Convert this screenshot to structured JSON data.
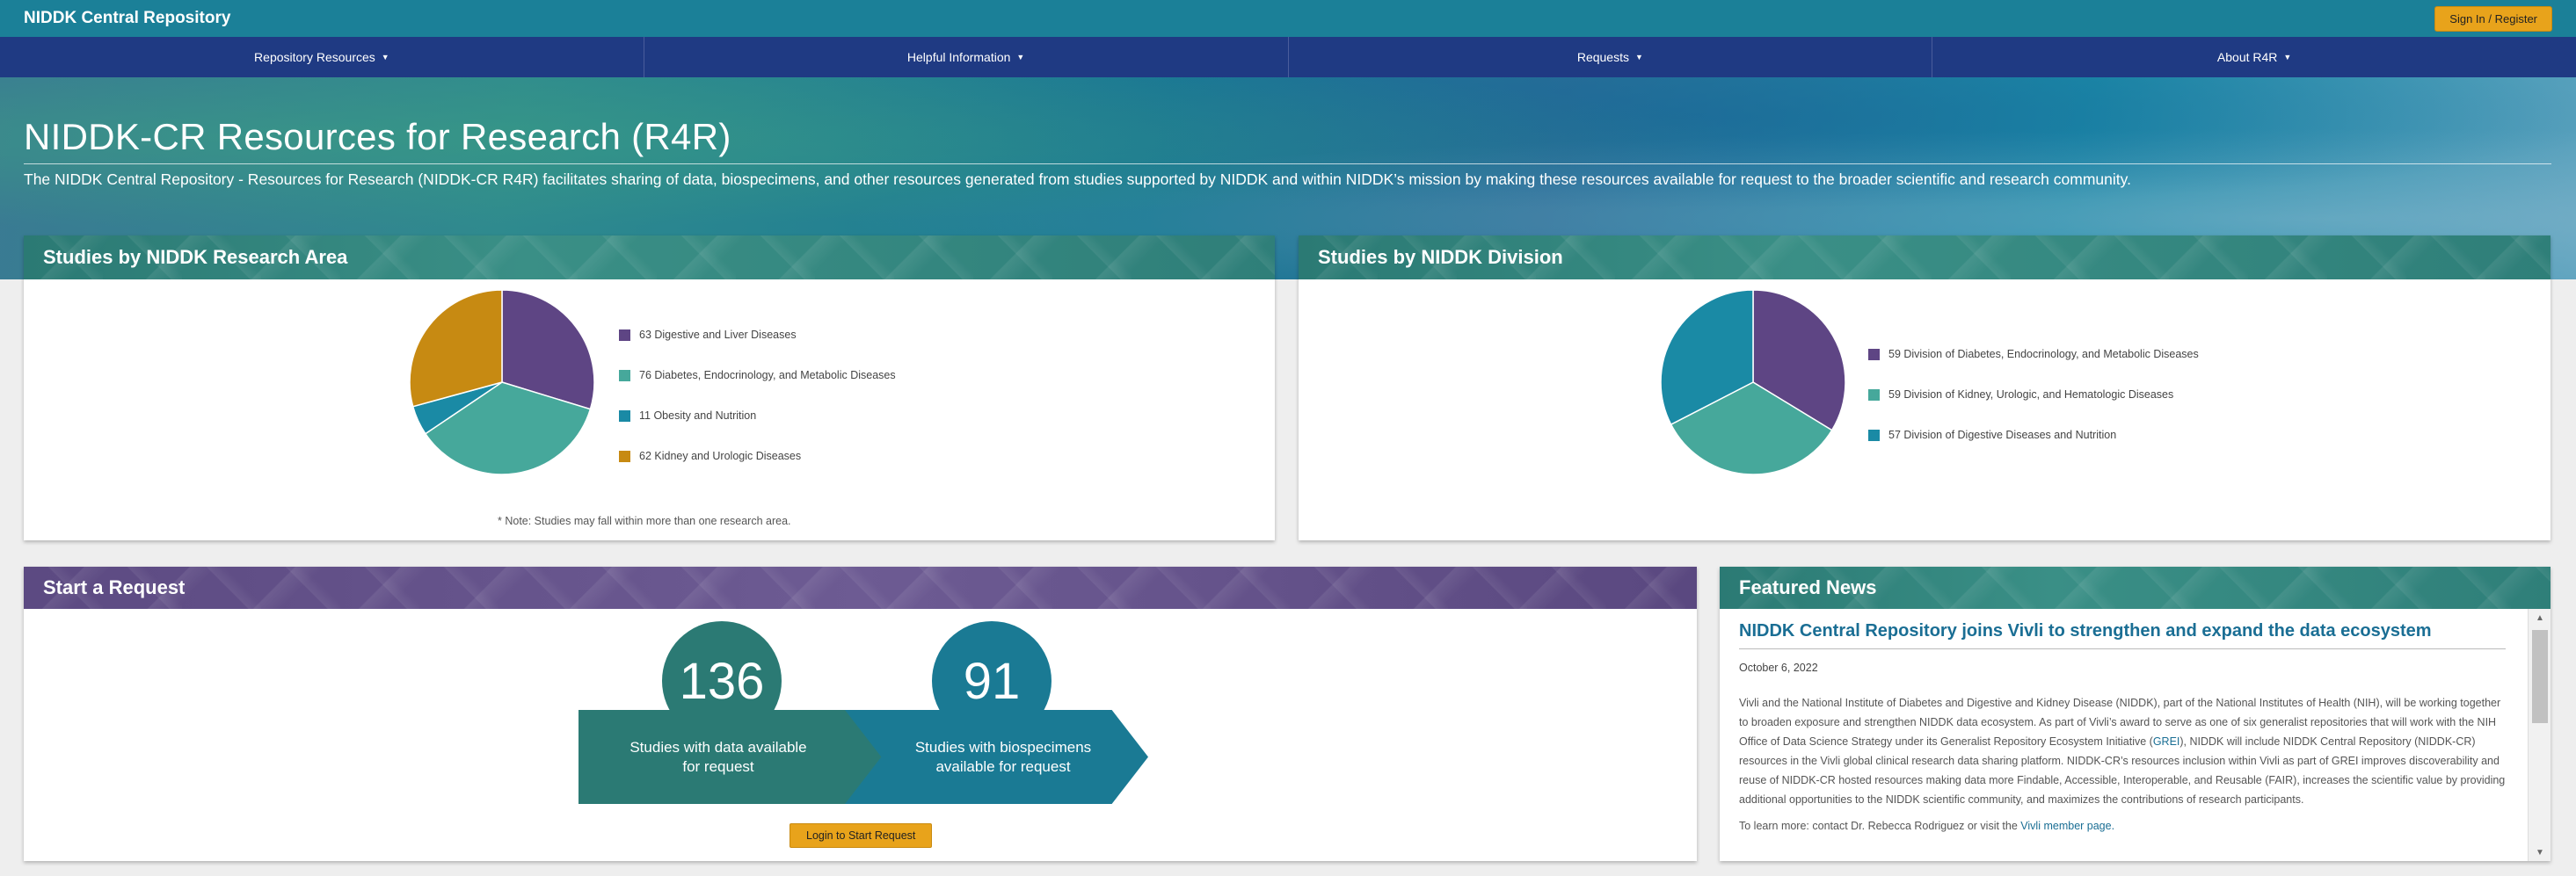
{
  "header": {
    "brand": "NIDDK Central Repository",
    "signin_label": "Sign In / Register"
  },
  "nav": {
    "items": [
      {
        "label": "Repository Resources"
      },
      {
        "label": "Helpful Information"
      },
      {
        "label": "Requests"
      },
      {
        "label": "About R4R"
      }
    ]
  },
  "hero": {
    "title": "NIDDK-CR Resources for Research (R4R)",
    "description": "The NIDDK Central Repository - Resources for Research (NIDDK-CR R4R) facilitates sharing of data, biospecimens, and other resources generated from studies supported by NIDDK and within NIDDK’s mission by making these resources available for request to the broader scientific and research community."
  },
  "colors": {
    "purple": "#5e4584",
    "teal": "#46a89b",
    "cyan": "#1a8aa5",
    "gold": "#c78a12"
  },
  "research_area": {
    "title": "Studies by NIDDK Research Area",
    "legend": [
      "63 Digestive and Liver Diseases",
      "76 Diabetes, Endocrinology, and Metabolic Diseases",
      "11 Obesity and Nutrition",
      "62 Kidney and Urologic Diseases"
    ],
    "note": "* Note: Studies may fall within more than one research area."
  },
  "division": {
    "title": "Studies by NIDDK Division",
    "legend": [
      "59 Division of Diabetes, Endocrinology, and Metabolic Diseases",
      "59 Division of Kidney, Urologic, and Hematologic Diseases",
      "57 Division of Digestive Diseases and Nutrition"
    ]
  },
  "chart_data": [
    {
      "type": "pie",
      "categories": [
        "Digestive and Liver Diseases",
        "Diabetes, Endocrinology, and Metabolic Diseases",
        "Obesity and Nutrition",
        "Kidney and Urologic Diseases"
      ],
      "values": [
        63,
        76,
        11,
        62
      ],
      "colors": [
        "#5e4584",
        "#46a89b",
        "#1a8aa5",
        "#c78a12"
      ],
      "title": "Studies by NIDDK Research Area",
      "legend": "right"
    },
    {
      "type": "pie",
      "categories": [
        "Division of Diabetes, Endocrinology, and Metabolic Diseases",
        "Division of Kidney, Urologic, and Hematologic Diseases",
        "Division of Digestive Diseases and Nutrition"
      ],
      "values": [
        59,
        59,
        57
      ],
      "colors": [
        "#5e4584",
        "#46a89b",
        "#1a8aa5"
      ],
      "title": "Studies by NIDDK Division",
      "legend": "right"
    }
  ],
  "request": {
    "title": "Start a Request",
    "data_count": "136",
    "data_label": "Studies with data available for request",
    "bio_count": "91",
    "bio_label": "Studies with biospecimens available for request",
    "login_label": "Login to Start Request"
  },
  "news": {
    "title": "Featured News",
    "headline": "NIDDK Central Repository joins Vivli to strengthen and expand the data ecosystem",
    "date": "October 6, 2022",
    "body_part1": "Vivli and the National Institute of Diabetes and Digestive and Kidney Disease (NIDDK), part of the National Institutes of Health (NIH), will be working together to broaden exposure and strengthen NIDDK data ecosystem. As part of Vivli’s award to serve as one of six generalist repositories that will work with the NIH Office of Data Science Strategy under its Generalist Repository Ecosystem Initiative (",
    "body_link": "GREI",
    "body_part2": "), NIDDK will include NIDDK Central Repository (NIDDK-CR) resources in the Vivli global clinical research data sharing platform. NIDDK-CR’s resources inclusion within Vivli as part of GREI improves discoverability and reuse of NIDDK-CR hosted resources making data more Findable, Accessible, Interoperable, and Reusable (FAIR), increases the scientific value by providing additional opportunities to the NIDDK scientific community, and maximizes the contributions of research participants.",
    "more_prefix": "To learn more: contact Dr. Rebecca Rodriguez or visit the ",
    "more_link": "Vivli member page."
  }
}
